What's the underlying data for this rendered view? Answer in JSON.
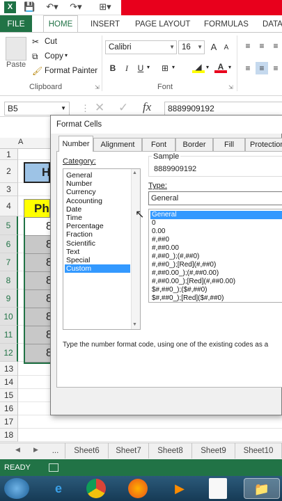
{
  "titlebar": {
    "app_icon": "X"
  },
  "ribbon_tabs": {
    "file": "FILE",
    "home": "HOME",
    "insert": "INSERT",
    "page_layout": "PAGE LAYOUT",
    "formulas": "FORMULAS",
    "data": "DATA"
  },
  "clipboard": {
    "paste": "Paste",
    "cut": "Cut",
    "copy": "Copy",
    "format_painter": "Format Painter",
    "group": "Clipboard"
  },
  "font": {
    "name": "Calibri",
    "size": "16",
    "group": "Font",
    "bold": "B",
    "italic": "I",
    "underline": "U",
    "grow": "A",
    "shrink": "A"
  },
  "formula_bar": {
    "name_box": "B5",
    "value": "8889909192",
    "fx": "fx"
  },
  "sheet": {
    "row_numbers": [
      "1",
      "2",
      "3",
      "4",
      "5",
      "6",
      "7",
      "8",
      "9",
      "10",
      "11",
      "12",
      "13",
      "14",
      "15",
      "16",
      "17",
      "18"
    ],
    "col_a": "A",
    "b2": "H",
    "b4": "Ph",
    "b_col_vals": [
      "8",
      "8",
      "8",
      "8",
      "8",
      "8",
      "8",
      "8"
    ]
  },
  "dialog": {
    "title": "Format Cells",
    "tabs": [
      "Number",
      "Alignment",
      "Font",
      "Border",
      "Fill",
      "Protection"
    ],
    "category_label": "Category:",
    "categories": [
      "General",
      "Number",
      "Currency",
      "Accounting",
      "Date",
      "Time",
      "Percentage",
      "Fraction",
      "Scientific",
      "Text",
      "Special",
      "Custom"
    ],
    "selected_category": "Custom",
    "sample_label": "Sample",
    "sample_value": "8889909192",
    "type_label": "Type:",
    "type_input": "General",
    "types": [
      "General",
      "0",
      "0.00",
      "#,##0",
      "#,##0.00",
      "#,##0_);(#,##0)",
      "#,##0_);[Red](#,##0)",
      "#,##0.00_);(#,##0.00)",
      "#,##0.00_);[Red](#,##0.00)",
      "$#,##0_);($#,##0)",
      "$#,##0_);[Red]($#,##0)"
    ],
    "description": "Type the number format code, using one of the existing codes as a"
  },
  "sheet_tabs": [
    "...",
    "Sheet6",
    "Sheet7",
    "Sheet8",
    "Sheet9",
    "Sheet10"
  ],
  "status": "READY",
  "colors": {
    "excel_green": "#217346",
    "selection_blue": "#3399ff",
    "header_blue": "#9dc3e6",
    "header_yellow": "#ffff00",
    "red_bar": "#e8001c"
  }
}
